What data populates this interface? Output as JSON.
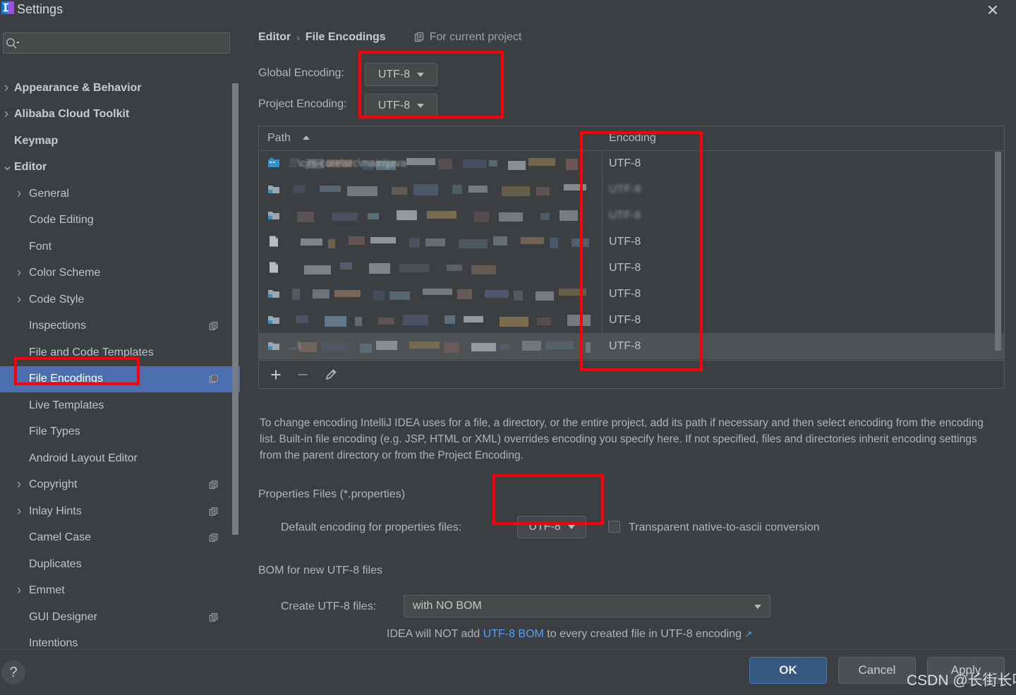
{
  "window": {
    "title": "Settings",
    "close_icon": "close-icon",
    "app_icon": "intellij-idea-logo"
  },
  "sidebar": {
    "search": {
      "placeholder": "",
      "value": "",
      "icon": "search-icon"
    },
    "items": [
      {
        "label": "Appearance & Behavior",
        "level": 0,
        "twisty": "collapsed",
        "badge": false,
        "selected": false
      },
      {
        "label": "Alibaba Cloud Toolkit",
        "level": 0,
        "twisty": "collapsed",
        "badge": false,
        "selected": false
      },
      {
        "label": "Keymap",
        "level": 0,
        "twisty": "none",
        "badge": false,
        "selected": false
      },
      {
        "label": "Editor",
        "level": 0,
        "twisty": "expanded",
        "badge": false,
        "selected": false
      },
      {
        "label": "General",
        "level": 1,
        "twisty": "collapsed",
        "badge": false,
        "selected": false
      },
      {
        "label": "Code Editing",
        "level": 1,
        "twisty": "none",
        "badge": false,
        "selected": false
      },
      {
        "label": "Font",
        "level": 1,
        "twisty": "none",
        "badge": false,
        "selected": false
      },
      {
        "label": "Color Scheme",
        "level": 1,
        "twisty": "collapsed",
        "badge": false,
        "selected": false
      },
      {
        "label": "Code Style",
        "level": 1,
        "twisty": "collapsed",
        "badge": false,
        "selected": false
      },
      {
        "label": "Inspections",
        "level": 1,
        "twisty": "none",
        "badge": true,
        "selected": false
      },
      {
        "label": "File and Code Templates",
        "level": 1,
        "twisty": "none",
        "badge": false,
        "selected": false
      },
      {
        "label": "File Encodings",
        "level": 1,
        "twisty": "none",
        "badge": true,
        "selected": true
      },
      {
        "label": "Live Templates",
        "level": 1,
        "twisty": "none",
        "badge": false,
        "selected": false
      },
      {
        "label": "File Types",
        "level": 1,
        "twisty": "none",
        "badge": false,
        "selected": false
      },
      {
        "label": "Android Layout Editor",
        "level": 1,
        "twisty": "none",
        "badge": false,
        "selected": false
      },
      {
        "label": "Copyright",
        "level": 1,
        "twisty": "collapsed",
        "badge": true,
        "selected": false
      },
      {
        "label": "Inlay Hints",
        "level": 1,
        "twisty": "collapsed",
        "badge": true,
        "selected": false
      },
      {
        "label": "Camel Case",
        "level": 1,
        "twisty": "none",
        "badge": true,
        "selected": false
      },
      {
        "label": "Duplicates",
        "level": 1,
        "twisty": "none",
        "badge": false,
        "selected": false
      },
      {
        "label": "Emmet",
        "level": 1,
        "twisty": "collapsed",
        "badge": false,
        "selected": false
      },
      {
        "label": "GUI Designer",
        "level": 1,
        "twisty": "none",
        "badge": true,
        "selected": false
      },
      {
        "label": "Intentions",
        "level": 1,
        "twisty": "none",
        "badge": false,
        "selected": false
      }
    ]
  },
  "main": {
    "breadcrumb": {
      "parent": "Editor",
      "separator": "›",
      "current": "File Encodings",
      "scope_icon": "project-scope-icon",
      "scope_label": "For current project"
    },
    "global_encoding": {
      "label": "Global Encoding:",
      "value": "UTF-8"
    },
    "project_encoding": {
      "label": "Project Encoding:",
      "value": "UTF-8"
    },
    "table": {
      "columns": [
        "Path",
        "Encoding"
      ],
      "sort_column": "Path",
      "sort_direction": "ascending",
      "rows": [
        {
          "path": "...\\cjrs-core\\src\\main\\java",
          "path_redacted": true,
          "encoding": "UTF-8",
          "encoding_redacted": false,
          "icon": "module-icon",
          "selected": false
        },
        {
          "path": "",
          "path_redacted": true,
          "encoding": "UTF-8",
          "encoding_redacted": true,
          "icon": "folder-icon",
          "selected": false
        },
        {
          "path": "",
          "path_redacted": true,
          "encoding": "UTF-8",
          "encoding_redacted": true,
          "icon": "folder-icon",
          "selected": false
        },
        {
          "path": "",
          "path_redacted": true,
          "encoding": "UTF-8",
          "encoding_redacted": false,
          "icon": "file-icon",
          "selected": false
        },
        {
          "path": "",
          "path_redacted": true,
          "encoding": "UTF-8",
          "encoding_redacted": false,
          "icon": "file-icon",
          "selected": false
        },
        {
          "path": "",
          "path_redacted": true,
          "encoding": "UTF-8",
          "encoding_redacted": false,
          "icon": "folder-icon",
          "selected": false
        },
        {
          "path": "",
          "path_redacted": true,
          "encoding": "UTF-8",
          "encoding_redacted": false,
          "icon": "folder-icon",
          "selected": false
        },
        {
          "path": "...\\",
          "path_redacted": true,
          "encoding": "UTF-8",
          "encoding_redacted": false,
          "icon": "folder-icon",
          "selected": true
        }
      ],
      "toolbar": {
        "add": "+",
        "remove": "−",
        "edit": "pencil-icon"
      }
    },
    "description": "To change encoding IntelliJ IDEA uses for a file, a directory, or the entire project, add its path if necessary and then select encoding from the encoding list. Built-in file encoding (e.g. JSP, HTML or XML) overrides encoding you specify here. If not specified, files and directories inherit encoding settings from the parent directory or from the Project Encoding.",
    "properties_group": {
      "title": "Properties Files (*.properties)",
      "default_encoding_label": "Default encoding for properties files:",
      "default_encoding_value": "UTF-8",
      "transparent_label": "Transparent native-to-ascii conversion",
      "transparent_checked": false
    },
    "bom_group": {
      "title": "BOM for new UTF-8 files",
      "create_label": "Create UTF-8 files:",
      "create_value": "with NO BOM",
      "note_prefix": "IDEA will NOT add ",
      "note_link": "UTF-8 BOM",
      "note_suffix": " to every created file in UTF-8 encoding",
      "note_external_icon": "↗"
    }
  },
  "footer": {
    "help": "?",
    "ok": "OK",
    "cancel": "Cancel",
    "apply": "Apply"
  },
  "watermark": "CSDN @长街长呀",
  "colors": {
    "background": "#3c3f41",
    "selection": "#4b6eaf",
    "annotation": "#fb0007",
    "link": "#589df6",
    "ok_button": "#365880"
  }
}
